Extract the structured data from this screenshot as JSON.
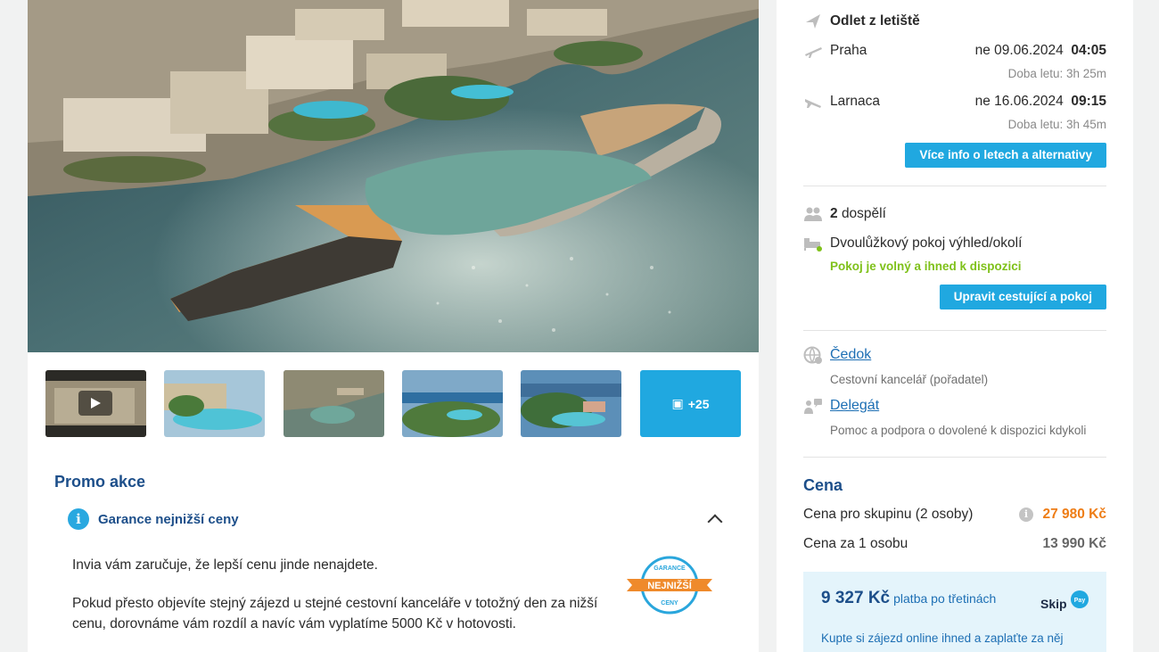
{
  "thumbnails": {
    "more_label": "+25"
  },
  "promo": {
    "title": "Promo akce",
    "guarantee_label": "Garance nejnižší ceny",
    "text1": "Invia vám zaručuje, že lepší cenu jinde nenajdete.",
    "text2": "Pokud přesto objevíte stejný zájezd u stejné cestovní kanceláře v totožný den za nižší cenu, dorovnáme vám rozdíl a navíc vám vyplatíme 5000 Kč v hotovosti.",
    "badge": {
      "top": "GARANCE",
      "middle": "NEJNIŽŠÍ",
      "bottom": "CENY"
    }
  },
  "flights": {
    "heading": "Odlet z letiště",
    "outbound": {
      "airport": "Praha",
      "date": "ne 09.06.2024",
      "time": "04:05",
      "duration": "Doba letu: 3h 25m"
    },
    "inbound": {
      "airport": "Larnaca",
      "date": "ne 16.06.2024",
      "time": "09:15",
      "duration": "Doba letu: 3h 45m"
    },
    "more_info_button": "Více info o letech a alternativy"
  },
  "travelers": {
    "count": "2",
    "label": "dospělí",
    "room": "Dvoulůžkový pokoj výhled/okolí",
    "availability": "Pokoj je volný a ihned k dispozici",
    "edit_button": "Upravit cestující a pokoj"
  },
  "organizer": {
    "name": "Čedok",
    "subtitle": "Cestovní kancelář (pořadatel)",
    "delegate": "Delegát",
    "delegate_subtitle": "Pomoc a podpora o dovolené k dispozici kdykoli"
  },
  "price": {
    "title": "Cena",
    "group_label": "Cena pro skupinu (2 osoby)",
    "group_value": "27 980 Kč",
    "person_label": "Cena za 1 osobu",
    "person_value": "13 990 Kč",
    "installment_amount": "9 327 Kč",
    "installment_label": "platba po třetinách",
    "installment_desc": "Kupte si zájezd online ihned a zaplaťte za něj",
    "skip_logo_text": "Skip",
    "skip_logo_pay": "Pay"
  },
  "colors": {
    "accent_blue": "#20a8e0",
    "heading_blue": "#1d4f8a",
    "price_orange": "#ee7d16",
    "available_green": "#7fc11a"
  }
}
